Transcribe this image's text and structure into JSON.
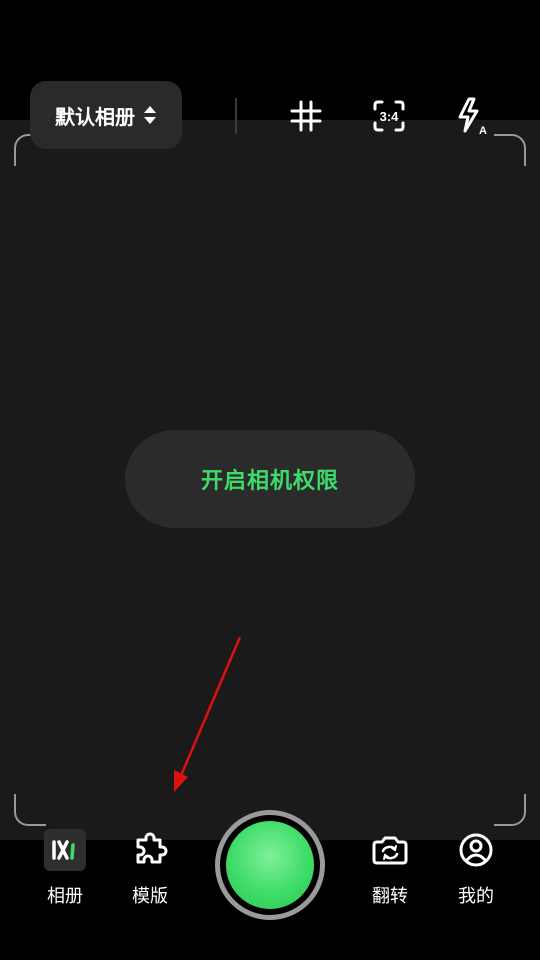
{
  "top_bar": {
    "album_select_label": "默认相册",
    "ratio_label": "3:4",
    "flash_mode_label": "A"
  },
  "viewfinder": {
    "permission_button_label": "开启相机权限"
  },
  "bottom_nav": {
    "album_label": "相册",
    "template_label": "模版",
    "flip_label": "翻转",
    "mine_label": "我的"
  },
  "colors": {
    "accent": "#3ddc6a",
    "background": "#000000",
    "viewfinder": "#1a1a1a",
    "annotation_arrow": "#e01010"
  },
  "icons": {
    "album_sort": "sort-updown-icon",
    "grid": "grid-icon",
    "ratio": "aspect-ratio-icon",
    "flash": "flash-auto-icon",
    "album_thumb": "album-thumbnail-icon",
    "template": "puzzle-icon",
    "flip": "camera-flip-icon",
    "mine": "user-profile-icon"
  }
}
